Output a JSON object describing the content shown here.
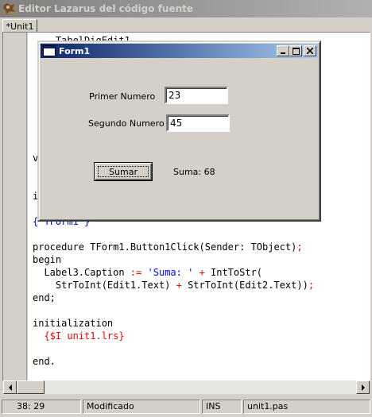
{
  "editor": {
    "title": "Editor Lazarus del código fuente",
    "tabs": [
      {
        "label": "*Unit1"
      }
    ],
    "code_lines": {
      "frag_line1": "    TabelDigEdit1",
      "frag_v": "v",
      "frag_i": "i",
      "frag_comment": "{ TForm1 }",
      "proc_kw": "procedure",
      "proc_sig": " TForm1.Button1Click(Sender: TObject)",
      "proc_semi": ";",
      "begin": "begin",
      "l3a": "  Label3.Caption ",
      "l3b": ":=",
      "l3c": " ",
      "l3d": "'Suma: '",
      "l3e": " + ",
      "l3f": "IntToStr(",
      "l4a": "    StrToInt(Edit1.Text) ",
      "l4b": "+",
      "l4c": " StrToInt(Edit2.Text))",
      "l4d": ";",
      "end1": "end;",
      "init": "initialization",
      "dir": "  {$I unit1.lrs}",
      "endfinal": "end."
    }
  },
  "statusbar": {
    "position": "38: 29",
    "modified": "Modificado",
    "mode": "INS",
    "file": "unit1.pas"
  },
  "form1": {
    "title": "Form1",
    "label1": "Primer Numero",
    "edit1_value": "23",
    "label2": "Segundo Numero",
    "edit2_value": "45",
    "button_label": "Sumar",
    "result_label": "Suma: 68",
    "caption_buttons": {
      "minimize": "_",
      "maximize": "□",
      "close": "✕"
    }
  }
}
